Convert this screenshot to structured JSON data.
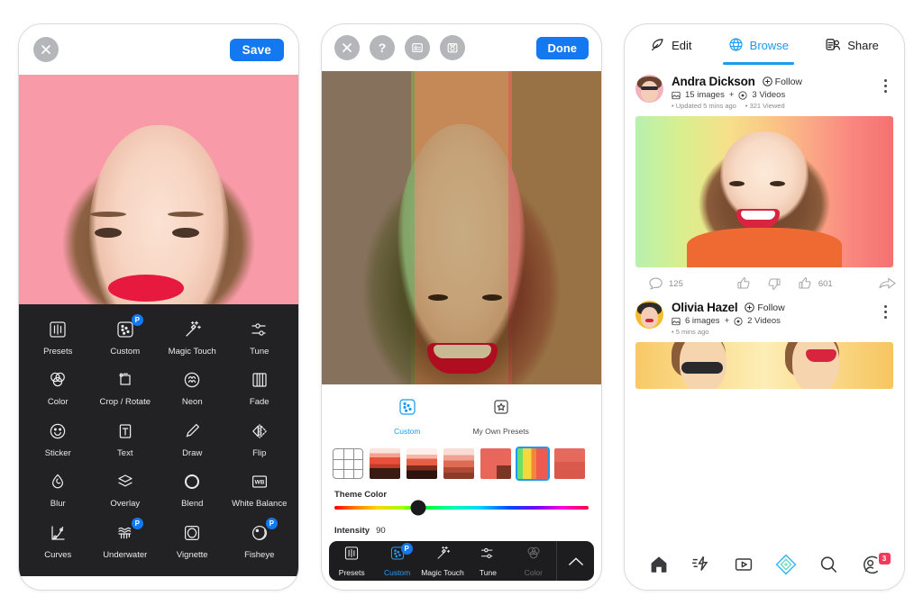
{
  "phone1": {
    "topbar": {
      "close_icon": "close-icon",
      "save_label": "Save"
    },
    "photo": {
      "background_color": "#f89aa8",
      "lip_color": "#e8193f"
    },
    "tools": [
      {
        "label": "Presets",
        "icon": "presets-icon",
        "pro": false
      },
      {
        "label": "Custom",
        "icon": "custom-icon",
        "pro": true,
        "pro_label": "P"
      },
      {
        "label": "Magic Touch",
        "icon": "magic-touch-icon",
        "pro": false
      },
      {
        "label": "Tune",
        "icon": "tune-icon",
        "pro": false
      },
      {
        "label": "Color",
        "icon": "color-icon",
        "pro": false
      },
      {
        "label": "Crop / Rotate",
        "icon": "crop-rotate-icon",
        "pro": false
      },
      {
        "label": "Neon",
        "icon": "neon-icon",
        "pro": false
      },
      {
        "label": "Fade",
        "icon": "fade-icon",
        "pro": false
      },
      {
        "label": "Sticker",
        "icon": "sticker-icon",
        "pro": false
      },
      {
        "label": "Text",
        "icon": "text-icon",
        "pro": false
      },
      {
        "label": "Draw",
        "icon": "draw-icon",
        "pro": false
      },
      {
        "label": "Flip",
        "icon": "flip-icon",
        "pro": false
      },
      {
        "label": "Blur",
        "icon": "blur-icon",
        "pro": false
      },
      {
        "label": "Overlay",
        "icon": "overlay-icon",
        "pro": false
      },
      {
        "label": "Blend",
        "icon": "blend-icon",
        "pro": false
      },
      {
        "label": "White Balance",
        "icon": "white-balance-icon",
        "pro": false
      },
      {
        "label": "Curves",
        "icon": "curves-icon",
        "pro": false
      },
      {
        "label": "Underwater",
        "icon": "underwater-icon",
        "pro": true,
        "pro_label": "P"
      },
      {
        "label": "Vignette",
        "icon": "vignette-icon",
        "pro": false
      },
      {
        "label": "Fisheye",
        "icon": "fisheye-icon",
        "pro": true,
        "pro_label": "P"
      }
    ]
  },
  "phone2": {
    "topbar": {
      "icons": [
        "close-icon",
        "help-icon",
        "compare-icon",
        "save-snapshot-icon"
      ],
      "done_label": "Done"
    },
    "photo": {
      "bands": [
        "#b3ca79",
        "#f8bb93",
        "#f58da2"
      ],
      "hair_tints": [
        "#22a02c",
        "#9a7c35",
        "#b72b2b"
      ]
    },
    "preset_tabs": [
      {
        "label": "Custom",
        "icon": "custom-icon",
        "active": true
      },
      {
        "label": "My Own Presets",
        "icon": "my-own-presets-icon",
        "active": false
      }
    ],
    "thumbnails": [
      {
        "name": "grid-thumb",
        "selected": false
      },
      {
        "name": "preset-1",
        "selected": false
      },
      {
        "name": "preset-2",
        "selected": false
      },
      {
        "name": "preset-3",
        "selected": false
      },
      {
        "name": "preset-4",
        "selected": false
      },
      {
        "name": "preset-5",
        "selected": true
      },
      {
        "name": "preset-6",
        "selected": false
      }
    ],
    "theme_color": {
      "label": "Theme Color",
      "knob_percent": 33
    },
    "intensity": {
      "label": "Intensity",
      "value": "90",
      "knob_percent": 88
    },
    "reset_icon": "reset-droplet-icon",
    "bottom_nav": [
      {
        "label": "Presets",
        "icon": "presets-icon",
        "active": false,
        "pro": false,
        "dim": false
      },
      {
        "label": "Custom",
        "icon": "custom-icon",
        "active": true,
        "pro": true,
        "pro_label": "P",
        "dim": false
      },
      {
        "label": "Magic Touch",
        "icon": "magic-touch-icon",
        "active": false,
        "pro": false,
        "dim": false
      },
      {
        "label": "Tune",
        "icon": "tune-icon",
        "active": false,
        "pro": false,
        "dim": false
      },
      {
        "label": "Color",
        "icon": "color-icon",
        "active": false,
        "pro": false,
        "dim": true
      }
    ],
    "expand_icon": "chevron-up-icon"
  },
  "phone3": {
    "tabs": [
      {
        "label": "Edit",
        "icon": "feather-edit-icon",
        "active": false
      },
      {
        "label": "Browse",
        "icon": "globe-icon",
        "active": true
      },
      {
        "label": "Share",
        "icon": "share-people-icon",
        "active": false
      }
    ],
    "accent_color": "#1a9bf0",
    "posts": [
      {
        "user": "Andra Dickson",
        "follow_label": "Follow",
        "images_count": "15 images",
        "plus": "+",
        "videos_count": "3 Videos",
        "updated": "Updated 5 mins ago",
        "viewed": "321 Viewed",
        "reactions": {
          "comments": "125",
          "likes": "601",
          "comment_icon": "comment-icon",
          "thumbs_up_icon": "thumbs-up-icon",
          "thumbs_down_icon": "thumbs-down-icon",
          "like_icon": "thumbs-up-filled-icon",
          "share_icon": "share-arrow-icon"
        }
      },
      {
        "user": "Olivia Hazel",
        "follow_label": "Follow",
        "images_count": "6 images",
        "plus": "+",
        "videos_count": "2 Videos",
        "updated": "5 mins ago"
      }
    ],
    "bottom_nav": [
      {
        "icon": "home-icon",
        "active": true,
        "badge": null
      },
      {
        "icon": "flash-icon",
        "active": false,
        "badge": null
      },
      {
        "icon": "video-icon",
        "active": false,
        "badge": null
      },
      {
        "icon": "discover-icon",
        "active": false,
        "badge": null,
        "highlight": true
      },
      {
        "icon": "search-icon",
        "active": false,
        "badge": null
      },
      {
        "icon": "profile-icon",
        "active": false,
        "badge": "3"
      }
    ]
  }
}
